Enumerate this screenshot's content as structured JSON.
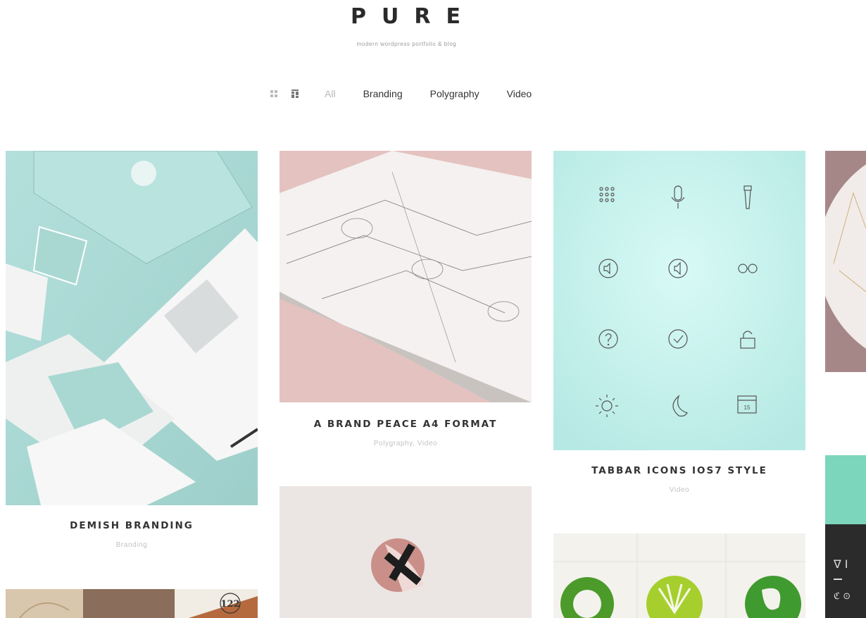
{
  "site": {
    "logo": "PURE",
    "tagline": "modern wordpress portfolio & blog"
  },
  "filters": {
    "view_icons": [
      "grid-view-icon",
      "masonry-view-icon"
    ],
    "items": [
      {
        "label": "All",
        "active": true
      },
      {
        "label": "Branding",
        "active": false
      },
      {
        "label": "Polygraphy",
        "active": false
      },
      {
        "label": "Video",
        "active": false
      }
    ]
  },
  "portfolio": {
    "items": [
      {
        "title": "DEMISH BRANDING",
        "category": "Branding"
      },
      {
        "title": "A BRAND PEACE A4 FORMAT",
        "category": "Polygraphy, Video"
      },
      {
        "title": "TABBAR ICONS IOS7 STYLE",
        "category": "Video"
      }
    ],
    "image_text": {
      "badge_number": "122",
      "calendar_day": "15",
      "poster_glyphs": "∇ I",
      "poster_symbols": "ℭ ⊙"
    }
  },
  "colors": {
    "mint": "#a9d8d3",
    "pink": "#e6c3c1",
    "icon_bg": "#c5f2ee",
    "accent_green": "#7cd6bc",
    "muted": "#c2c2c2"
  }
}
